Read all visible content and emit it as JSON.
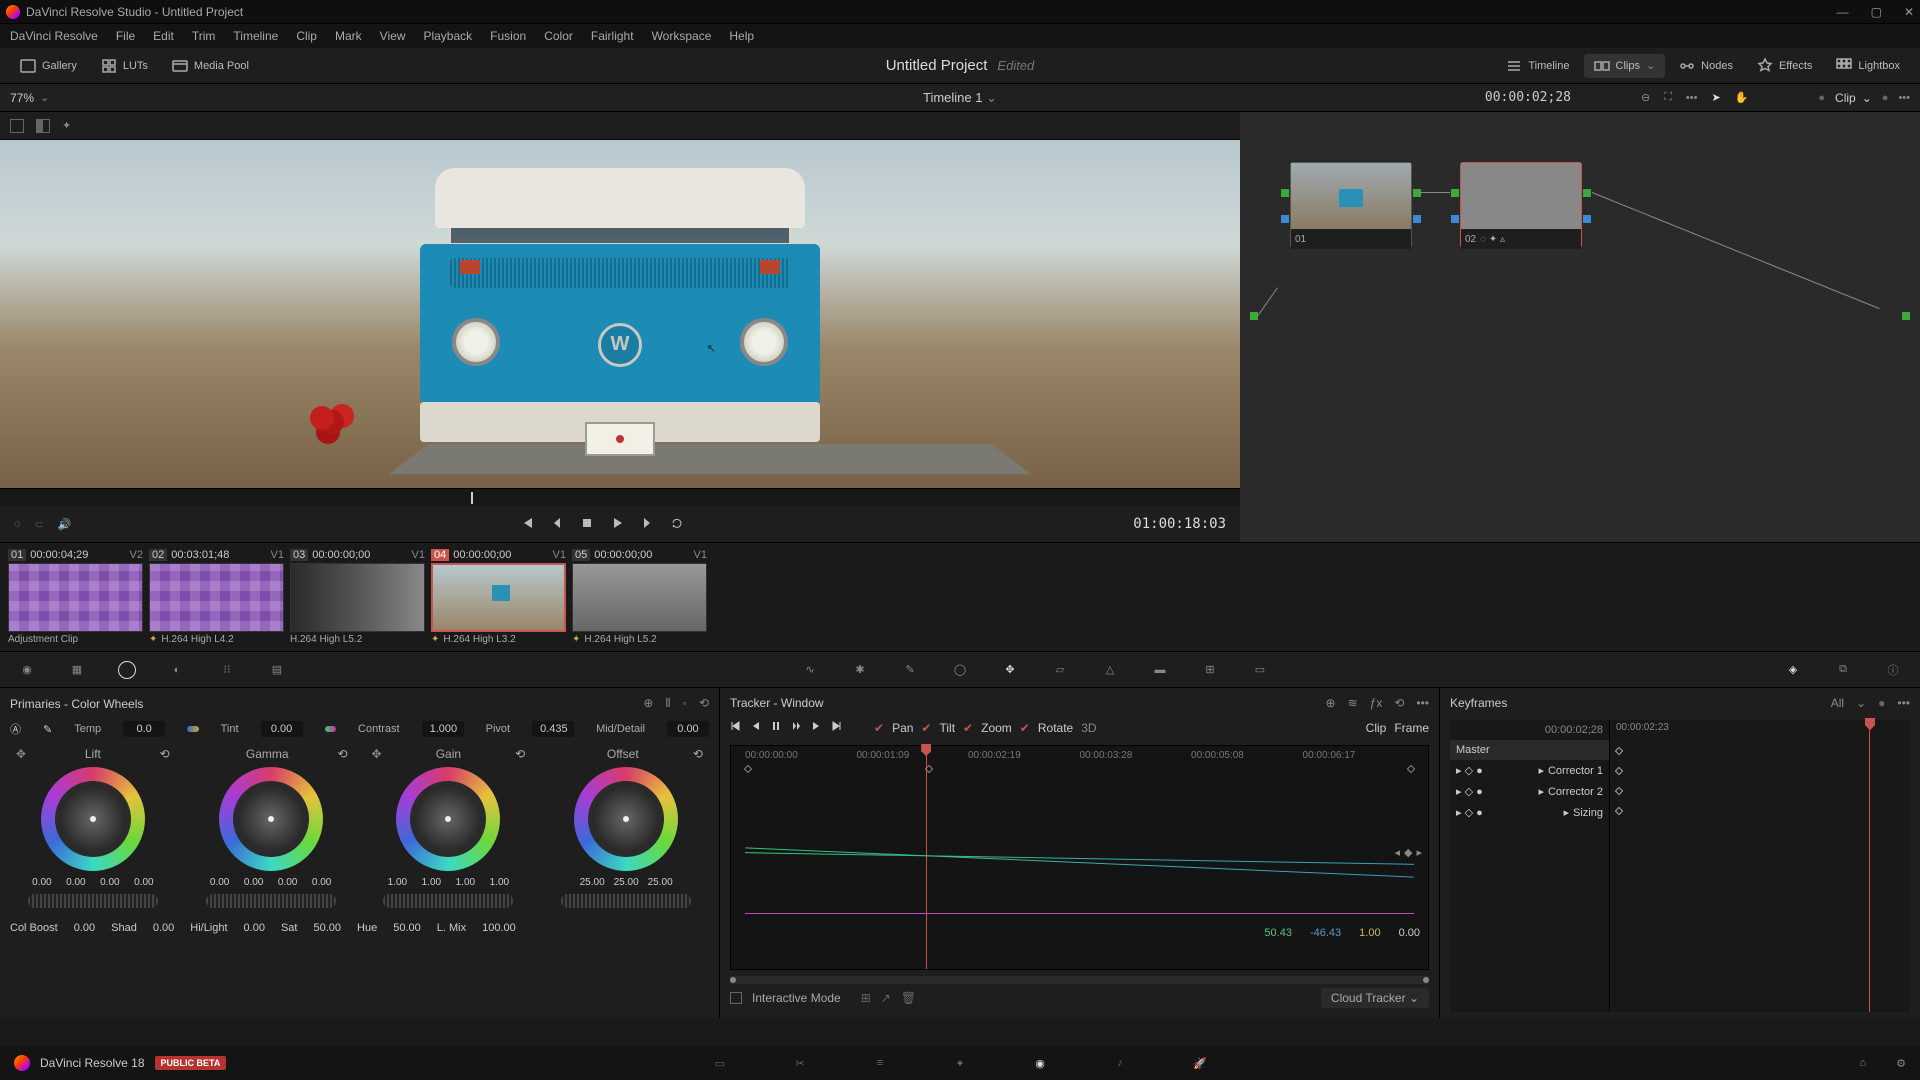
{
  "titlebar": {
    "text": "DaVinci Resolve Studio - Untitled Project"
  },
  "menubar": [
    "DaVinci Resolve",
    "File",
    "Edit",
    "Trim",
    "Timeline",
    "Clip",
    "Mark",
    "View",
    "Playback",
    "Fusion",
    "Color",
    "Fairlight",
    "Workspace",
    "Help"
  ],
  "toolbar_left": [
    {
      "label": "Gallery"
    },
    {
      "label": "LUTs"
    },
    {
      "label": "Media Pool"
    }
  ],
  "toolbar_right": [
    {
      "label": "Timeline"
    },
    {
      "label": "Clips"
    },
    {
      "label": "Nodes"
    },
    {
      "label": "Effects"
    },
    {
      "label": "Lightbox"
    }
  ],
  "project": {
    "title": "Untitled Project",
    "status": "Edited"
  },
  "subbar": {
    "zoom": "77%",
    "timeline_label": "Timeline 1",
    "timecode": "00:00:02;28",
    "clip_drop": "Clip"
  },
  "viewer": {
    "timecode": "01:00:18:03"
  },
  "nodes": {
    "n1": "01",
    "n2": "02"
  },
  "clips": [
    {
      "num": "01",
      "tc": "00:00:04;29",
      "trk": "V2",
      "codec": "Adjustment Clip"
    },
    {
      "num": "02",
      "tc": "00:03:01;48",
      "trk": "V1",
      "codec": "H.264 High L4.2"
    },
    {
      "num": "03",
      "tc": "00:00:00;00",
      "trk": "V1",
      "codec": "H.264 High L5.2"
    },
    {
      "num": "04",
      "tc": "00:00:00;00",
      "trk": "V1",
      "codec": "H.264 High L3.2",
      "active": true
    },
    {
      "num": "05",
      "tc": "00:00:00;00",
      "trk": "V1",
      "codec": "H.264 High L5.2"
    }
  ],
  "primaries": {
    "title": "Primaries - Color Wheels",
    "temp": {
      "label": "Temp",
      "value": "0.0"
    },
    "tint": {
      "label": "Tint",
      "value": "0.00"
    },
    "contrast": {
      "label": "Contrast",
      "value": "1.000"
    },
    "pivot": {
      "label": "Pivot",
      "value": "0.435"
    },
    "middetail": {
      "label": "Mid/Detail",
      "value": "0.00"
    },
    "wheels": [
      {
        "name": "Lift",
        "vals": [
          "0.00",
          "0.00",
          "0.00",
          "0.00"
        ]
      },
      {
        "name": "Gamma",
        "vals": [
          "0.00",
          "0.00",
          "0.00",
          "0.00"
        ]
      },
      {
        "name": "Gain",
        "vals": [
          "1.00",
          "1.00",
          "1.00",
          "1.00"
        ]
      },
      {
        "name": "Offset",
        "vals": [
          "25.00",
          "25.00",
          "25.00"
        ]
      }
    ],
    "bottom": [
      {
        "label": "Col Boost",
        "value": "0.00"
      },
      {
        "label": "Shad",
        "value": "0.00"
      },
      {
        "label": "Hi/Light",
        "value": "0.00"
      },
      {
        "label": "Sat",
        "value": "50.00"
      },
      {
        "label": "Hue",
        "value": "50.00"
      },
      {
        "label": "L. Mix",
        "value": "100.00"
      }
    ]
  },
  "tracker": {
    "title": "Tracker - Window",
    "pan": "Pan",
    "tilt": "Tilt",
    "zoom": "Zoom",
    "rotate": "Rotate",
    "threeD": "3D",
    "clip_btn": "Clip",
    "frame_btn": "Frame",
    "ticks": [
      "00:00:00:00",
      "00:00:01:09",
      "00:00:02:19",
      "00:00:03:28",
      "00:00:05:08",
      "00:00:06:17"
    ],
    "vals": {
      "x": "50.43",
      "y": "-46.43",
      "z": "1.00",
      "r": "0.00"
    },
    "interactive": "Interactive Mode",
    "cloud": "Cloud Tracker"
  },
  "keyframes": {
    "title": "Keyframes",
    "mode": "All",
    "tc_left": "00:00:02;28",
    "tc_right": "00:00:02:23",
    "rows": [
      "Master",
      "Corrector 1",
      "Corrector 2",
      "Sizing"
    ]
  },
  "footer": {
    "version": "DaVinci Resolve 18",
    "beta": "PUBLIC BETA"
  }
}
